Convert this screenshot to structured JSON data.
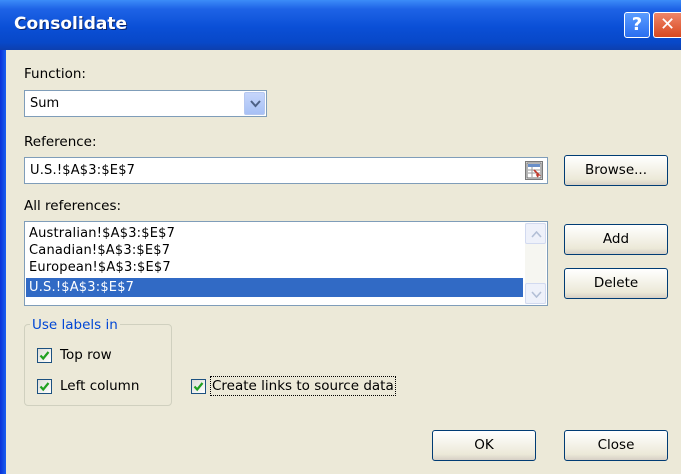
{
  "window": {
    "title": "Consolidate",
    "help_glyph": "?",
    "close_glyph": "✕"
  },
  "function": {
    "label": "Function:",
    "value": "Sum"
  },
  "reference": {
    "label": "Reference:",
    "value": "U.S.!$A$3:$E$7",
    "browse_label": "Browse..."
  },
  "all_references": {
    "label": "All references:",
    "items": [
      "Australian!$A$3:$E$7",
      "Canadian!$A$3:$E$7",
      "European!$A$3:$E$7",
      "U.S.!$A$3:$E$7"
    ],
    "selected_index": 3
  },
  "buttons": {
    "add": "Add",
    "delete": "Delete",
    "ok": "OK",
    "close": "Close"
  },
  "use_labels": {
    "legend": "Use labels in",
    "top_row": {
      "label": "Top row",
      "checked": true
    },
    "left_column": {
      "label": "Left column",
      "checked": true
    }
  },
  "create_links": {
    "label": "Create links to source data",
    "checked": true
  },
  "colors": {
    "titlebar": "#0a4fd6",
    "selection": "#316ac5",
    "dialog_bg": "#ece9d8",
    "group_legend": "#0046d5"
  }
}
